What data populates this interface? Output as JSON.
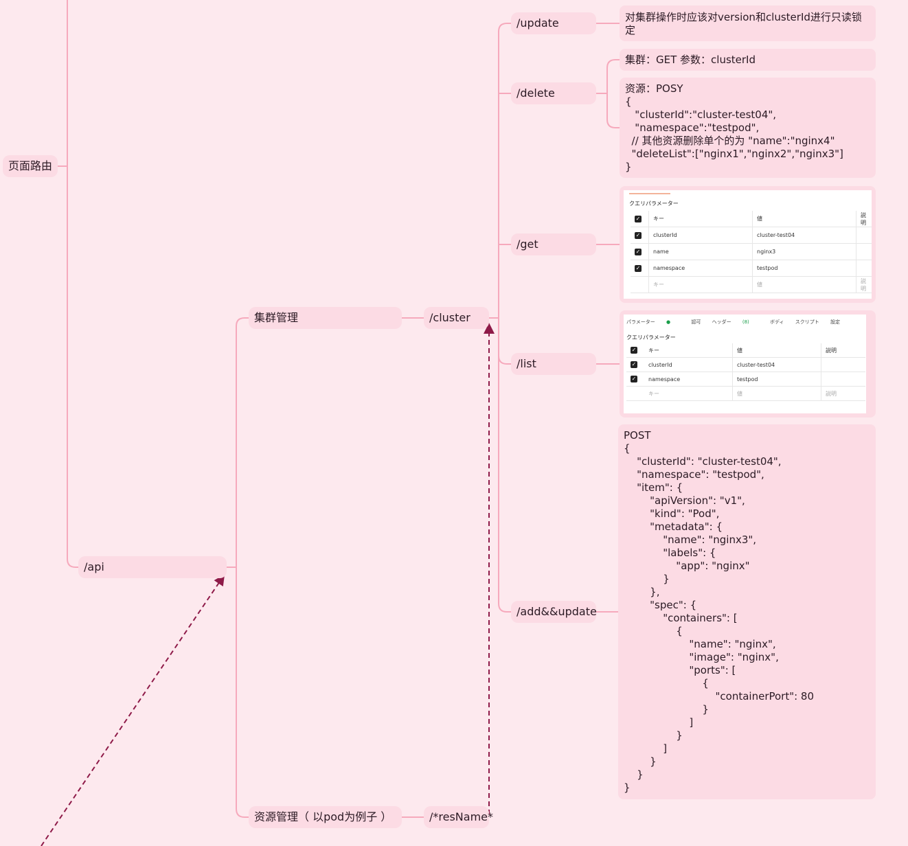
{
  "nodes": {
    "page_route": "页面路由",
    "api": "/api",
    "cluster_mgmt": "集群管理",
    "resource_mgmt": "资源管理（ 以pod为例子 ）",
    "cluster": "/cluster",
    "res_name": "/*resName*",
    "update": "/update",
    "delete": "/delete",
    "get": "/get",
    "list": "/list",
    "add_update": "/add&&update"
  },
  "notes": {
    "update_note": "对集群操作时应该对version和clusterId进行只读锁定",
    "delete_cluster": "集群：GET 参数：clusterId",
    "delete_resource": "资源：POSY\n{\n   \"clusterId\":\"cluster-test04\",\n   \"namespace\":\"testpod\",\n  // 其他资源删除单个的为 \"name\":\"nginx4\"\n  \"deleteList\":[\"nginx1\",\"nginx2\",\"nginx3\"]\n}",
    "add_update_body": "POST\n{\n    \"clusterId\": \"cluster-test04\",\n    \"namespace\": \"testpod\",\n    \"item\": {\n        \"apiVersion\": \"v1\",\n        \"kind\": \"Pod\",\n        \"metadata\": {\n            \"name\": \"nginx3\",\n            \"labels\": {\n                \"app\": \"nginx\"\n            }\n        },\n        \"spec\": {\n            \"containers\": [\n                {\n                    \"name\": \"nginx\",\n                    \"image\": \"nginx\",\n                    \"ports\": [\n                        {\n                            \"containerPort\": 80\n                        }\n                    ]\n                }\n            ]\n        }\n    }\n}"
  },
  "get_shot": {
    "title": "クエリパラメーター",
    "header": {
      "key": "キー",
      "value": "値",
      "desc": "説明"
    },
    "rows": [
      {
        "key": "clusterId",
        "value": "cluster-test04"
      },
      {
        "key": "name",
        "value": "nginx3"
      },
      {
        "key": "namespace",
        "value": "testpod"
      }
    ],
    "placeholder": {
      "key": "キー",
      "value": "値",
      "desc": "説明"
    }
  },
  "list_shot": {
    "tabs": [
      "パラメーター",
      "認可",
      "ヘッダー",
      "(8)",
      "ボディ",
      "スクリプト",
      "設定"
    ],
    "title": "クエリパラメーター",
    "header": {
      "key": "キー",
      "value": "値",
      "desc": "説明"
    },
    "rows": [
      {
        "key": "clusterId",
        "value": "cluster-test04"
      },
      {
        "key": "namespace",
        "value": "testpod"
      }
    ],
    "placeholder": {
      "key": "キー",
      "value": "値",
      "desc": "説明"
    }
  },
  "colors": {
    "background": "#fde9ee",
    "node_fill": "#fcdbe4",
    "branch_line": "#f6a9bc",
    "dashed_arrow": "#8e1a48"
  }
}
